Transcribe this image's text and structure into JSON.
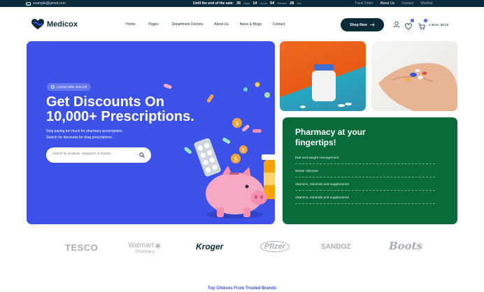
{
  "topbar": {
    "email": "example@gmail.com",
    "countdown": {
      "label": "Until the end of the sale:",
      "days": "35",
      "days_unit": "Days",
      "hours": "14",
      "hours_unit": "Hours",
      "minutes": "54",
      "minutes_unit": "Minutes",
      "seconds": "28",
      "seconds_unit": "Sec"
    },
    "links": [
      "Track Order",
      "About Us",
      "Contact",
      "Wishlist"
    ]
  },
  "header": {
    "brand": "Medicox",
    "nav": [
      "Home",
      "Pages",
      "Department Doctors",
      "About Us",
      "News & Blogs",
      "Contact"
    ],
    "shop_button": "Shop Now",
    "wishlist_count": "0",
    "cart_count": "0",
    "cart_total": "0 items: $0.00"
  },
  "hero": {
    "offer_badge": "Limited Offer 25% Off",
    "title_line1": "Get Discounts On",
    "title_line2": "10,000+ Prescriptions.",
    "subtitle_line1": "Stop paying too much for pharmacy prescriptions.",
    "subtitle_line2": "Search for discounts for drug prescriptions.",
    "search_placeholder": "Search for products, categories or brands..."
  },
  "pharmacy_card": {
    "title": "Pharmacy at your fingertips!",
    "items": [
      "Diet and weight management",
      "Winter skincare",
      "Vitamins, minerals and supplements",
      "Vitamins, minerals and supplements"
    ]
  },
  "brands": [
    "TESCO",
    "Walmart",
    "Pharmacy",
    "Kroger",
    "Pfizer",
    "SANDOZ",
    "Boots"
  ],
  "section_title": "Top Choices From Trusted Brands",
  "colors": {
    "navy": "#0b2a3a",
    "hero_blue": "#3b51e8",
    "pharmacy_green": "#0a6b3a",
    "brand_gray": "#a8aeb4"
  }
}
